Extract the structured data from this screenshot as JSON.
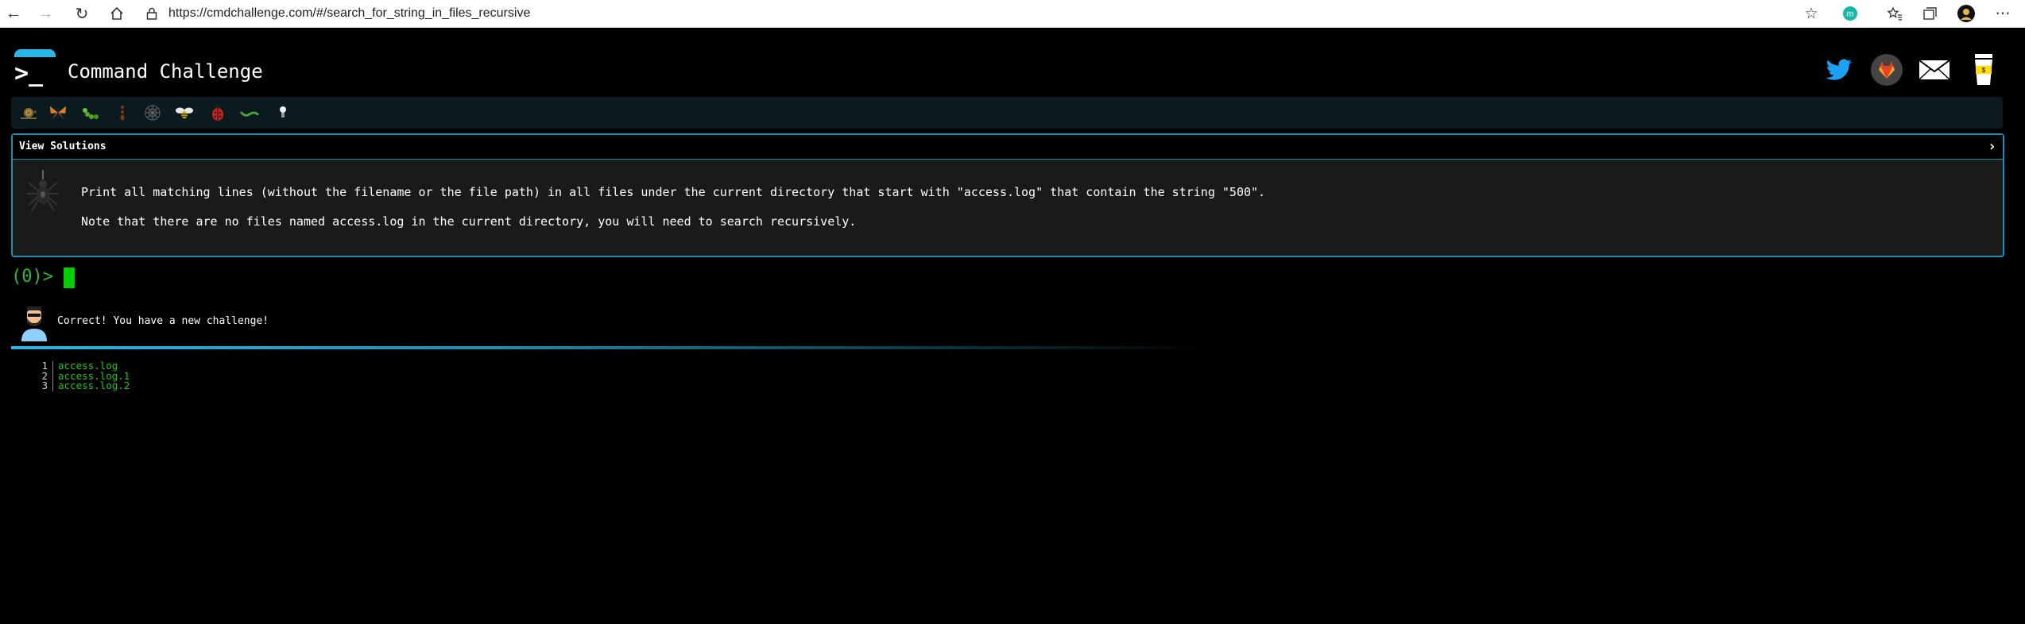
{
  "browser": {
    "url": "https://cmdchallenge.com/#/search_for_string_in_files_recursive"
  },
  "header": {
    "logo_glyph": ">_",
    "title": "Command Challenge"
  },
  "social": [
    "twitter-icon",
    "gitlab-icon",
    "mail-icon",
    "coffee-icon"
  ],
  "levels": [
    "snail",
    "butterfly",
    "caterpillar",
    "ant",
    "spider-web",
    "bee",
    "ladybug",
    "worm",
    "bulb"
  ],
  "challenge": {
    "section_label": "View Solutions",
    "task_line1": "Print all matching lines (without the filename or the file path) in all files under the current directory that start with \"access.log\" that contain the string \"500\".",
    "task_line2": "Note that there are no files named access.log in the current directory, you will need to search recursively."
  },
  "terminal": {
    "prompt": "(0)>"
  },
  "result": {
    "message": "Correct! You have a new challenge!"
  },
  "output": {
    "lines": [
      {
        "n": "1",
        "text": "access.log"
      },
      {
        "n": "2",
        "text": "access.log.1"
      },
      {
        "n": "3",
        "text": "access.log.2"
      }
    ]
  },
  "colors": {
    "accent": "#29b6e8",
    "box_border": "#1d8fb0",
    "prompt_green": "#2eb82e",
    "output_green": "#22c422"
  }
}
